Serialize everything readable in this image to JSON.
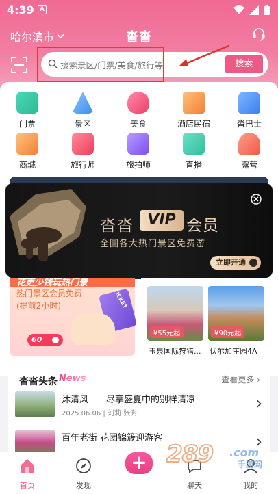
{
  "status_bar": {
    "time": "4:39",
    "notification_letter": "A"
  },
  "header": {
    "city": "哈尔滨市",
    "app_title": "沓沓"
  },
  "search": {
    "placeholder": "搜索景区/门票/美食/旅行等",
    "button": "搜索"
  },
  "categories": [
    {
      "label": "门票",
      "icon": "ticket-icon",
      "color": "#35c9a6"
    },
    {
      "label": "景区",
      "icon": "mountain-icon",
      "color": "#57a8f2"
    },
    {
      "label": "美食",
      "icon": "heart-food-icon",
      "color": "#f0507a"
    },
    {
      "label": "酒店民宿",
      "icon": "hotel-icon",
      "color": "#f59a4a"
    },
    {
      "label": "沓巴士",
      "icon": "bus-icon",
      "color": "#4a90f0"
    },
    {
      "label": "商城",
      "icon": "shop-icon",
      "color": "#f59a4a"
    },
    {
      "label": "旅行师",
      "icon": "suitcase-icon",
      "color": "#f0506a"
    },
    {
      "label": "旅拍师",
      "icon": "camera-icon",
      "color": "#8a5cf0"
    },
    {
      "label": "直播",
      "icon": "live-icon",
      "color": "#35c9a6"
    },
    {
      "label": "露营",
      "icon": "tent-icon",
      "color": "#f06a6a"
    }
  ],
  "vip_popup": {
    "brand": "沓沓",
    "vip_label": "VIP",
    "member_label": "会员",
    "subtitle": "全国各大热门景区免费游",
    "open_button": "立即开通"
  },
  "promo_left": {
    "title": "花更少钱玩热门景",
    "line1": "热门景区会员免费",
    "line2": "(提前2小时)",
    "badge": "60",
    "ticket_text": "TICKET"
  },
  "promo_right": [
    {
      "price": "¥55元起",
      "label": "玉泉国际狩猎..."
    },
    {
      "price": "¥90元起",
      "label": "伏尔加庄园4A"
    }
  ],
  "news": {
    "title": "沓沓头条",
    "tag": "News",
    "more": "查看更多 ›",
    "items": [
      {
        "title": "沐清风——尽享盛夏中的别样清凉",
        "meta": "2025.06.06 | 刘莉 张澍"
      },
      {
        "title": "百年老街 花团锦簇迎游客",
        "meta": ""
      }
    ]
  },
  "watermark": {
    "number": "289",
    "domain": ".com",
    "text": "手游网"
  },
  "bottom_nav": [
    {
      "label": "首页",
      "icon": "home-icon",
      "active": true
    },
    {
      "label": "发现",
      "icon": "discover-icon",
      "active": false
    },
    {
      "label": "",
      "icon": "plus-icon",
      "active": false
    },
    {
      "label": "聊天",
      "icon": "chat-icon",
      "active": false
    },
    {
      "label": "我的",
      "icon": "profile-icon",
      "active": false
    }
  ]
}
